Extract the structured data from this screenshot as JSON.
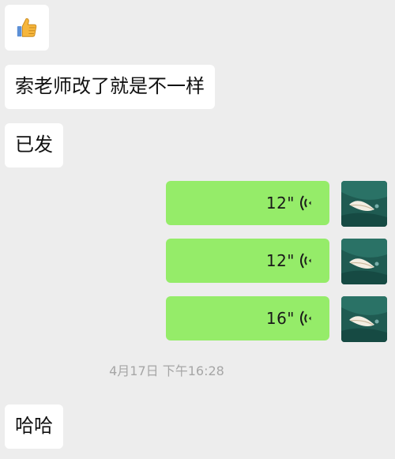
{
  "messages": {
    "received": [
      {
        "icon": "thumbs-up-icon"
      },
      {
        "text": "索老师改了就是不一样"
      },
      {
        "text": "已发"
      },
      {
        "text": "哈哈"
      }
    ],
    "voice": [
      {
        "duration": "12\""
      },
      {
        "duration": "12\""
      },
      {
        "duration": "16\""
      }
    ],
    "timestamp": "4月17日 下午16:28"
  },
  "colors": {
    "background": "#ededed",
    "incoming_bubble": "#ffffff",
    "outgoing_bubble": "#95ec69",
    "timestamp_text": "#a6a6a6"
  }
}
